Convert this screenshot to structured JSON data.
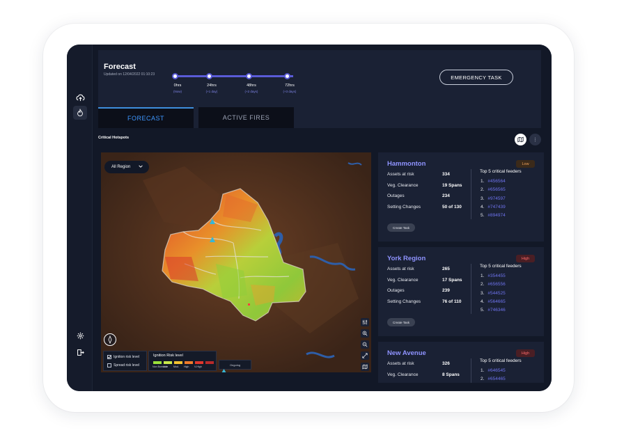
{
  "header": {
    "title": "Forecast",
    "updated": "Updated on 12/04/2022 01:10:23",
    "emergency_label": "EMERGENCY TASK"
  },
  "timeline": [
    {
      "label": "0hrs",
      "sub": "(Now)"
    },
    {
      "label": "24hrs",
      "sub": "(+1 day)"
    },
    {
      "label": "48hrs",
      "sub": "(+2 days)"
    },
    {
      "label": "72hrs",
      "sub": "(+3 days)"
    }
  ],
  "tabs": {
    "forecast": "FORECAST",
    "active_fires": "ACTIVE FIRES"
  },
  "section_label": "Critical Hotspots",
  "map": {
    "region_dropdown": "All Region",
    "layers": {
      "ignition": "Ignition risk level",
      "spread": "Spread risk level"
    },
    "legend": {
      "title": "Ignition Risk level",
      "levels": [
        "Non Burnable",
        "Low",
        "Mod.",
        "High",
        "V-High",
        ""
      ],
      "colors": [
        "#9be23a",
        "#c9e94a",
        "#f2c230",
        "#f07b2a",
        "#e0362c",
        "#b82a2a"
      ]
    },
    "time_pill": "Ongoing"
  },
  "card_labels": {
    "assets": "Assets at risk",
    "veg": "Veg. Clearance",
    "outages": "Outages",
    "settings": "Setting Changes",
    "feeders_title": "Top 5 critical feeders",
    "create": "Create Task"
  },
  "cards": [
    {
      "name": "Hammonton",
      "risk": "Low",
      "assets": "334",
      "veg": "19 Spans",
      "outages": "234",
      "settings": "50 of 130",
      "feeders": [
        "#456564",
        "#656565",
        "#974597",
        "#747439",
        "#894974"
      ]
    },
    {
      "name": "York Region",
      "risk": "High",
      "assets": "265",
      "veg": "17 Spans",
      "outages": "239",
      "settings": "76 of 110",
      "feeders": [
        "#354455",
        "#656556",
        "#544525",
        "#564665",
        "#746346"
      ]
    },
    {
      "name": "New Avenue",
      "risk": "High",
      "assets": "326",
      "veg": "8 Spans",
      "outages": "",
      "settings": "",
      "feeders": [
        "#646545",
        "#654465",
        "",
        "",
        ""
      ]
    }
  ]
}
